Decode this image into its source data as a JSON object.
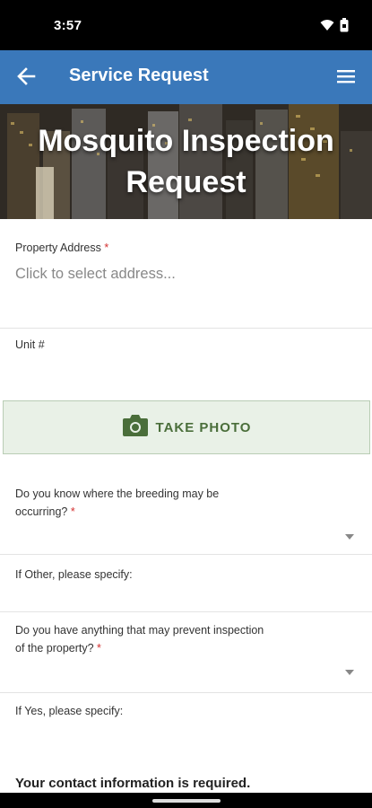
{
  "status": {
    "time": "3:57"
  },
  "app_bar": {
    "title": "Service Request"
  },
  "hero": {
    "title": "Mosquito Inspection Request"
  },
  "form": {
    "property_address": {
      "label": "Property Address",
      "required_mark": "*",
      "placeholder": "Click to select address..."
    },
    "unit": {
      "label": "Unit #"
    },
    "take_photo": {
      "label": "TAKE PHOTO"
    },
    "breeding": {
      "label_line1": "Do you know where the breeding may be",
      "label_line2": "occurring?",
      "required_mark": "*"
    },
    "breeding_other": {
      "label": "If Other, please specify:"
    },
    "prevent": {
      "label_line1": "Do you have anything that may prevent inspection",
      "label_line2": "of the property?",
      "required_mark": "*"
    },
    "prevent_yes": {
      "label": "If Yes, please specify:"
    },
    "contact_heading": "Your contact information is required."
  },
  "colors": {
    "app_bar": "#3a78ba",
    "photo_button_bg": "#e9f1e7",
    "photo_button_text": "#4a6e3a",
    "required": "#d32f2f"
  }
}
